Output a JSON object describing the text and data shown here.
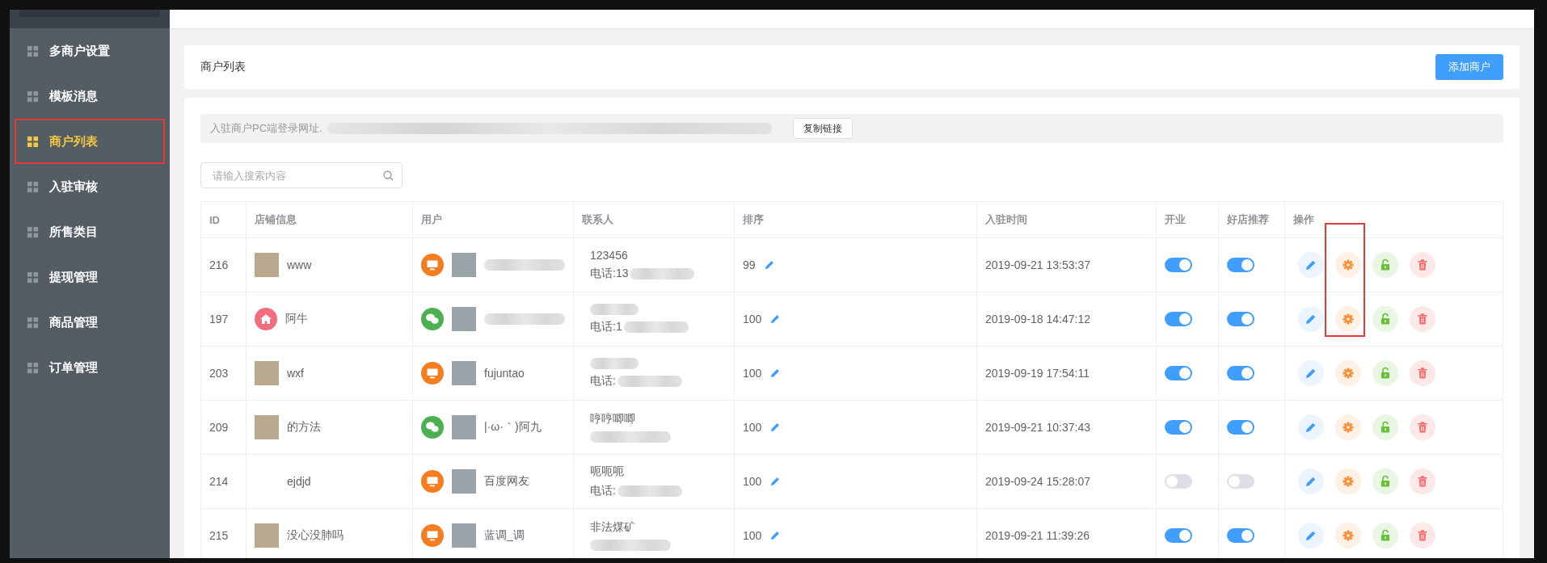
{
  "sidebar": {
    "items": [
      {
        "label": "多商户设置",
        "selected": false,
        "annotated": false
      },
      {
        "label": "模板消息",
        "selected": false,
        "annotated": false
      },
      {
        "label": "商户列表",
        "selected": true,
        "annotated": true
      },
      {
        "label": "入驻审核",
        "selected": false,
        "annotated": false
      },
      {
        "label": "所售类目",
        "selected": false,
        "annotated": false
      },
      {
        "label": "提现管理",
        "selected": false,
        "annotated": false
      },
      {
        "label": "商品管理",
        "selected": false,
        "annotated": false
      },
      {
        "label": "订单管理",
        "selected": false,
        "annotated": false
      }
    ]
  },
  "page_header": {
    "title": "商户列表",
    "add_button": "添加商户"
  },
  "login_url": {
    "label": "入驻商户PC端登录网址.",
    "copy_button": "复制链接"
  },
  "search": {
    "placeholder": "请输入搜索内容"
  },
  "table": {
    "columns": [
      "ID",
      "店铺信息",
      "用户",
      "联系人",
      "排序",
      "入驻时间",
      "开业",
      "好店推荐",
      "操作"
    ],
    "rows": [
      {
        "id": "216",
        "store_logo": {
          "kind": "photo"
        },
        "store": "www",
        "user_icon": {
          "kind": "pc"
        },
        "contact_name": "123456",
        "phone": "电话:13",
        "sort": "99",
        "joined": "2019-09-21 13:53:37",
        "open": true,
        "recommended": true,
        "gear_annotated": true
      },
      {
        "id": "197",
        "store_logo": {
          "kind": "home"
        },
        "store": "阿牛",
        "user_icon": {
          "kind": "wechat"
        },
        "phone": "电话:1",
        "sort": "100",
        "joined": "2019-09-18 14:47:12",
        "open": true,
        "recommended": true,
        "gear_annotated": true
      },
      {
        "id": "203",
        "store_logo": {
          "kind": "photo"
        },
        "store": "wxf",
        "user_icon": {
          "kind": "pc"
        },
        "user_name": "fujuntao",
        "phone": "电话:",
        "sort": "100",
        "joined": "2019-09-19 17:54:11",
        "open": true,
        "recommended": true,
        "gear_annotated": false
      },
      {
        "id": "209",
        "store_logo": {
          "kind": "photo"
        },
        "store": "的方法",
        "user_icon": {
          "kind": "wechat"
        },
        "user_name": "|·ω·｀)阿九",
        "contact_name": "哼哼唧唧",
        "sort": "100",
        "joined": "2019-09-21 10:37:43",
        "open": true,
        "recommended": true,
        "gear_annotated": false
      },
      {
        "id": "214",
        "store": "ejdjd",
        "user_icon": {
          "kind": "pc"
        },
        "user_name": "百度网友",
        "contact_name": "呃呃呃",
        "phone": "电话:",
        "sort": "100",
        "joined": "2019-09-24 15:28:07",
        "open": false,
        "recommended": false,
        "gear_annotated": false
      },
      {
        "id": "215",
        "store_logo": {
          "kind": "photo"
        },
        "store": "没心没肺吗",
        "user_icon": {
          "kind": "pc"
        },
        "user_name": "蓝调_调",
        "contact_name": "非法煤矿",
        "sort": "100",
        "joined": "2019-09-21 11:39:26",
        "open": true,
        "recommended": true,
        "gear_annotated": false
      }
    ]
  }
}
